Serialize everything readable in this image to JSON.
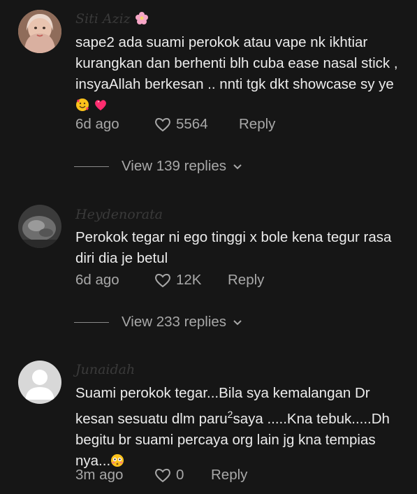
{
  "comments": [
    {
      "username": "Siti Aziz",
      "text_parts": [
        "sape2 ada suami perokok atau vape nk ikhtiar kurangkan dan berhenti blh cuba ease nasal stick , insyaAllah berkesan .. nnti tgk dkt showcase sy ye"
      ],
      "time": "6d ago",
      "likes": "5564",
      "reply_label": "Reply",
      "view_replies": "View 139 replies"
    },
    {
      "username": "Heydenorata",
      "text_parts": [
        "Perokok tegar ni ego tinggi x bole kena tegur rasa diri dia je betul"
      ],
      "time": "6d ago",
      "likes": "12K",
      "reply_label": "Reply",
      "view_replies": "View 233 replies"
    },
    {
      "username": "Junaidah",
      "text_parts": [
        "Suami perokok tegar...Bila sya kemalangan Dr kesan sesuatu dlm paru",
        "2",
        "saya .....Kna tebuk.....Dh begitu br suami percaya org lain jg kna tempias nya..."
      ],
      "time": "3m ago",
      "likes": "0",
      "reply_label": "Reply"
    }
  ],
  "colors": {
    "background": "#161616",
    "text": "#ececec",
    "secondary": "#a8a8a8",
    "username_dim": "#3a3a3a",
    "emoji_heart": "#ff2d6f"
  }
}
